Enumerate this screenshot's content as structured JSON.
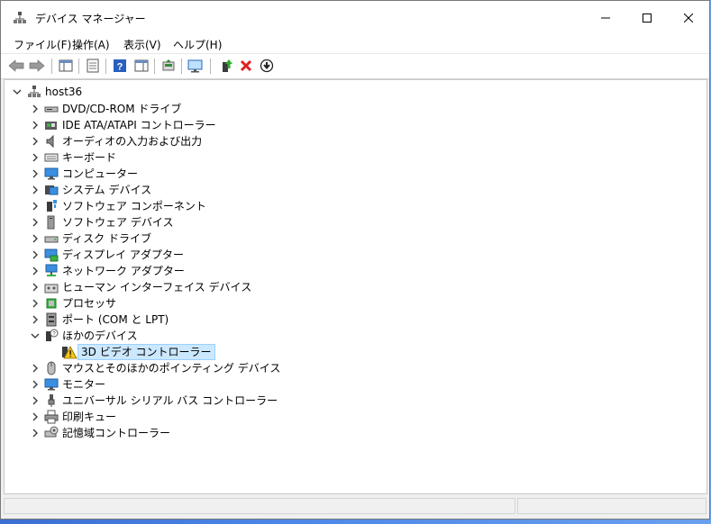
{
  "window": {
    "title": "デバイス マネージャー"
  },
  "menu": [
    {
      "label": "ファイル(F)"
    },
    {
      "label": "操作(A)"
    },
    {
      "label": "表示(V)"
    },
    {
      "label": "ヘルプ(H)"
    }
  ],
  "tree": {
    "root": {
      "label": "host36"
    },
    "items": [
      {
        "label": "DVD/CD-ROM ドライブ",
        "icon": "dvd-drive-icon"
      },
      {
        "label": "IDE ATA/ATAPI コントローラー",
        "icon": "ide-controller-icon"
      },
      {
        "label": "オーディオの入力および出力",
        "icon": "speaker-icon"
      },
      {
        "label": "キーボード",
        "icon": "keyboard-icon"
      },
      {
        "label": "コンピューター",
        "icon": "computer-icon"
      },
      {
        "label": "システム デバイス",
        "icon": "system-device-icon"
      },
      {
        "label": "ソフトウェア コンポーネント",
        "icon": "software-component-icon"
      },
      {
        "label": "ソフトウェア デバイス",
        "icon": "software-device-icon"
      },
      {
        "label": "ディスク ドライブ",
        "icon": "disk-drive-icon"
      },
      {
        "label": "ディスプレイ アダプター",
        "icon": "display-adapter-icon"
      },
      {
        "label": "ネットワーク アダプター",
        "icon": "network-adapter-icon"
      },
      {
        "label": "ヒューマン インターフェイス デバイス",
        "icon": "hid-icon"
      },
      {
        "label": "プロセッサ",
        "icon": "processor-icon"
      },
      {
        "label": "ポート (COM と LPT)",
        "icon": "port-icon"
      },
      {
        "label": "ほかのデバイス",
        "icon": "unknown-device-icon",
        "expanded": true
      },
      {
        "label": "マウスとそのほかのポインティング デバイス",
        "icon": "mouse-icon"
      },
      {
        "label": "モニター",
        "icon": "monitor-icon"
      },
      {
        "label": "ユニバーサル シリアル バス コントローラー",
        "icon": "usb-icon"
      },
      {
        "label": "印刷キュー",
        "icon": "printer-icon"
      },
      {
        "label": "記憶域コントローラー",
        "icon": "storage-controller-icon"
      }
    ],
    "child": {
      "label": "3D ビデオ コントローラー",
      "icon": "warning-device-icon"
    }
  },
  "colors": {
    "selection_bg": "#cce8ff",
    "selection_border": "#99d1ff",
    "delete_red": "#e02020"
  }
}
